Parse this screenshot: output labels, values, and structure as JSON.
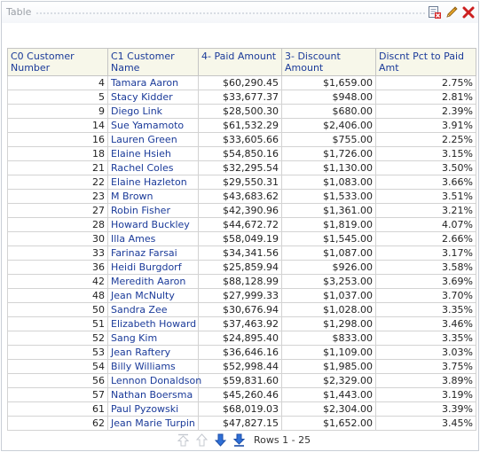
{
  "title": "Table",
  "columns": [
    "C0 Customer Number",
    "C1 Customer Name",
    "4- Paid Amount",
    "3- Discount Amount",
    "Discnt Pct to Paid Amt"
  ],
  "rows": [
    [
      "4",
      "Tamara Aaron",
      "$60,290.45",
      "$1,659.00",
      "2.75%"
    ],
    [
      "5",
      "Stacy Kidder",
      "$33,677.37",
      "$948.00",
      "2.81%"
    ],
    [
      "9",
      "Diego Link",
      "$28,500.30",
      "$680.00",
      "2.39%"
    ],
    [
      "14",
      "Sue Yamamoto",
      "$61,532.29",
      "$2,406.00",
      "3.91%"
    ],
    [
      "16",
      "Lauren Green",
      "$33,605.66",
      "$755.00",
      "2.25%"
    ],
    [
      "18",
      "Elaine Hsieh",
      "$54,850.16",
      "$1,726.00",
      "3.15%"
    ],
    [
      "21",
      "Rachel Coles",
      "$32,295.54",
      "$1,130.00",
      "3.50%"
    ],
    [
      "22",
      "Elaine Hazleton",
      "$29,550.31",
      "$1,083.00",
      "3.66%"
    ],
    [
      "23",
      "M Brown",
      "$43,683.62",
      "$1,533.00",
      "3.51%"
    ],
    [
      "27",
      "Robin Fisher",
      "$42,390.96",
      "$1,361.00",
      "3.21%"
    ],
    [
      "28",
      "Howard Buckley",
      "$44,672.72",
      "$1,819.00",
      "4.07%"
    ],
    [
      "30",
      "Illa Ames",
      "$58,049.19",
      "$1,545.00",
      "2.66%"
    ],
    [
      "33",
      "Farinaz Farsai",
      "$34,341.56",
      "$1,087.00",
      "3.17%"
    ],
    [
      "36",
      "Heidi Burgdorf",
      "$25,859.94",
      "$926.00",
      "3.58%"
    ],
    [
      "42",
      "Meredith Aaron",
      "$88,128.99",
      "$3,253.00",
      "3.69%"
    ],
    [
      "48",
      "Jean McNulty",
      "$27,999.33",
      "$1,037.00",
      "3.70%"
    ],
    [
      "50",
      "Sandra Zee",
      "$30,676.94",
      "$1,028.00",
      "3.35%"
    ],
    [
      "51",
      "Elizabeth Howard",
      "$37,463.92",
      "$1,298.00",
      "3.46%"
    ],
    [
      "52",
      "Sang Kim",
      "$24,895.40",
      "$833.00",
      "3.35%"
    ],
    [
      "53",
      "Jean Raftery",
      "$36,646.16",
      "$1,109.00",
      "3.03%"
    ],
    [
      "54",
      "Billy Williams",
      "$52,998.44",
      "$1,985.00",
      "3.75%"
    ],
    [
      "56",
      "Lennon Donaldson",
      "$59,831.60",
      "$2,329.00",
      "3.89%"
    ],
    [
      "57",
      "Nathan Boersma",
      "$45,260.46",
      "$1,443.00",
      "3.19%"
    ],
    [
      "61",
      "Paul Pyzowski",
      "$68,019.03",
      "$2,304.00",
      "3.39%"
    ],
    [
      "62",
      "Jean Marie Turpin",
      "$47,827.15",
      "$1,652.00",
      "3.45%"
    ]
  ],
  "pager": {
    "rows_label": "Rows 1 - 25"
  },
  "colors": {
    "header_bg": "#f7f7ea",
    "link": "#1a3a99",
    "close": "#cc1f1f",
    "arrow_active": "#2f6fd6"
  },
  "icons": [
    "properties-icon",
    "edit-pencil-icon",
    "close-icon",
    "first-page-icon",
    "previous-page-icon",
    "next-page-icon",
    "last-page-icon"
  ]
}
